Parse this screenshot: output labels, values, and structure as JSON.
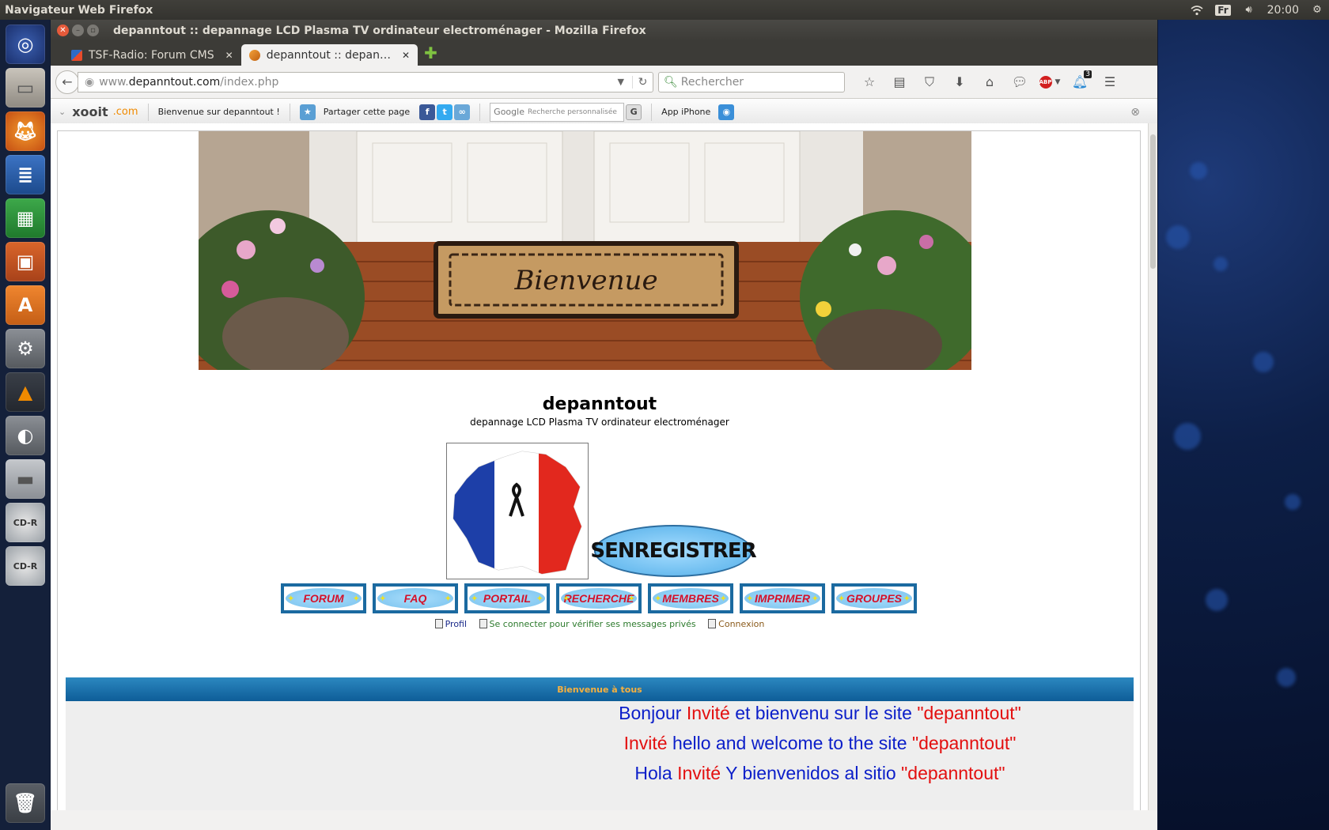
{
  "top_panel": {
    "app_title": "Navigateur Web Firefox",
    "keyboard_layout": "Fr",
    "clock": "20:00"
  },
  "launcher": {
    "items": [
      "ubuntu-dash",
      "files",
      "firefox",
      "writer",
      "calc",
      "impress",
      "software-center",
      "system-settings",
      "vlc",
      "disk-usage",
      "drive",
      "cd-r",
      "cd-r",
      "trash"
    ],
    "cd_label": "CD-R"
  },
  "window": {
    "title": "depanntout :: depannage LCD Plasma TV ordinateur electroménager - Mozilla Firefox"
  },
  "tabs": [
    {
      "label": "TSF-Radio: Forum CMS"
    },
    {
      "label": "depanntout :: depan…"
    }
  ],
  "navbar": {
    "url_prefix": "www.",
    "url_host": "depanntout.com",
    "url_path": "/index.php",
    "search_placeholder": "Rechercher",
    "notif_count": "3"
  },
  "xooit": {
    "logo": "xooit",
    "logo_suffix": ".com",
    "welcome": "Bienvenue sur depanntout !",
    "share": "Partager cette page",
    "google_label": "Google",
    "google_placeholder": "Recherche personnalisée",
    "iphone": "App iPhone"
  },
  "site": {
    "banner_text": "Bienvenue",
    "title": "depanntout",
    "description": "depannage LCD Plasma TV ordinateur electroménager",
    "register_label": "SENREGISTRER"
  },
  "nav_buttons": [
    "FORUM",
    "FAQ",
    "PORTAIL",
    "RECHERCHE",
    "MEMBRES",
    "IMPRIMER",
    "GROUPES"
  ],
  "user_links": {
    "profile": "Profil",
    "messages": "Se connecter pour vérifier ses messages privés",
    "login": "Connexion"
  },
  "welcome": {
    "header": "Bienvenue à tous",
    "line1": {
      "a": "Bonjour ",
      "b": "Invité",
      "c": " et bienvenu sur le site ",
      "d": "\"depanntout\""
    },
    "line2": {
      "a": "Invité",
      "b": " hello and welcome to the site ",
      "c": "\"depanntout\""
    },
    "line3": {
      "a": "Hola ",
      "b": "Invité",
      "c": " Y bienvenidos al sitio ",
      "d": "\"depanntout\""
    }
  },
  "colors": {
    "nav_border": "#1b6aa0",
    "nav_text": "#d4112a",
    "welcome_blue": "#0b1ec9",
    "welcome_red": "#e30f0f",
    "header_bar": "#0e5d98"
  }
}
